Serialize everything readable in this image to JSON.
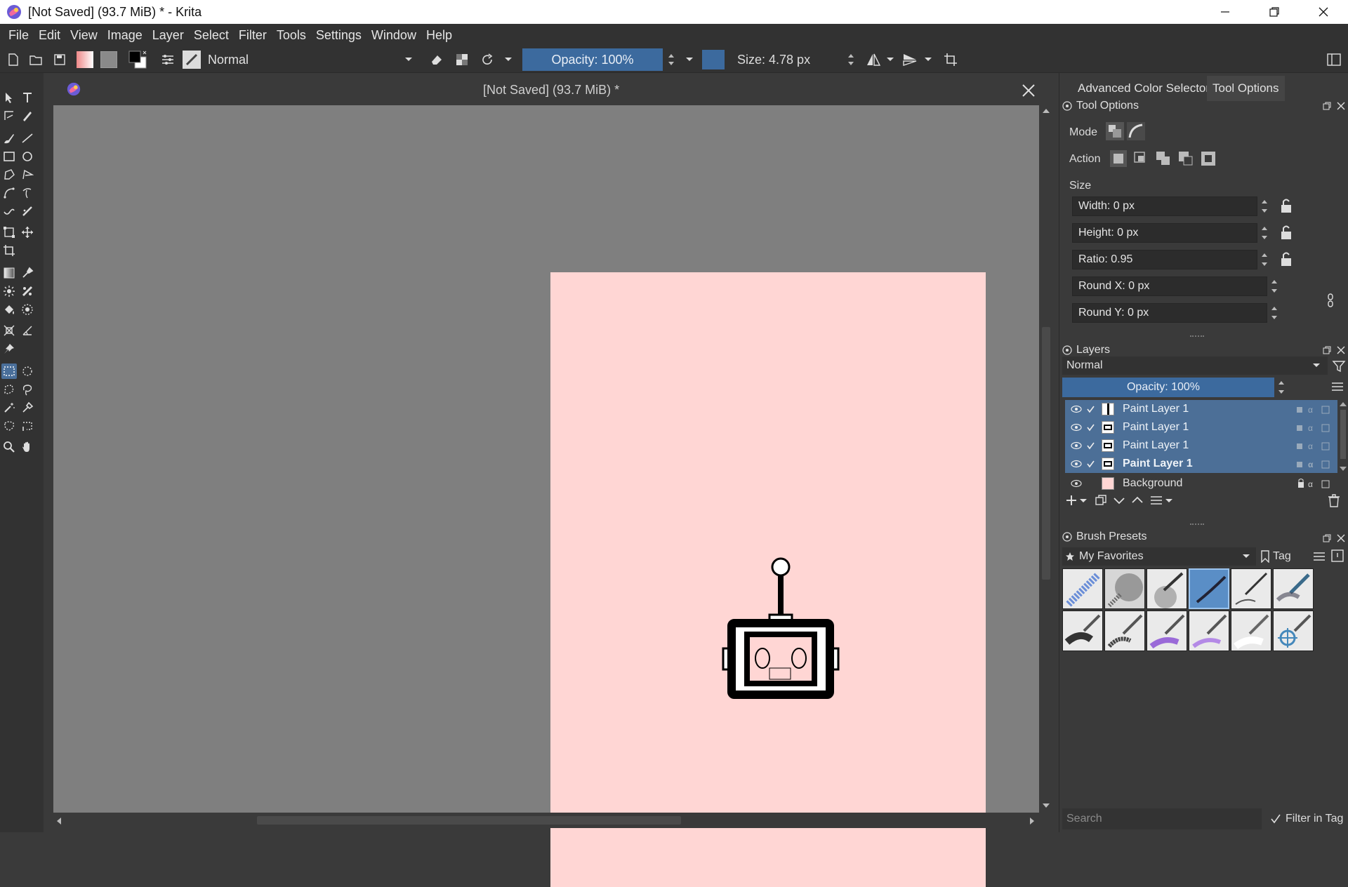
{
  "window": {
    "title": "[Not Saved]  (93.7 MiB) * - Krita"
  },
  "menubar": [
    "File",
    "Edit",
    "View",
    "Image",
    "Layer",
    "Select",
    "Filter",
    "Tools",
    "Settings",
    "Window",
    "Help"
  ],
  "toolbar": {
    "blend_mode": "Normal",
    "opacity": "Opacity: 100%",
    "opacity_value": 1.0,
    "size": "Size: 4.78 px"
  },
  "document": {
    "tab_title": "[Not Saved]  (93.7 MiB) *",
    "canvas_color": "#ffd6d4"
  },
  "dock": {
    "tabs": [
      "Advanced Color Selector",
      "Tool Options"
    ],
    "active_tab": "Tool Options",
    "tool_options": {
      "title": "Tool Options",
      "mode_label": "Mode",
      "action_label": "Action",
      "size_label": "Size",
      "width": "Width: 0 px",
      "height": "Height: 0 px",
      "ratio": "Ratio: 0.95",
      "round_x": "Round X: 0 px",
      "round_y": "Round Y: 0 px"
    },
    "layers": {
      "title": "Layers",
      "blend_mode": "Normal",
      "opacity": "Opacity: 100%",
      "items": [
        {
          "name": "Paint Layer 1",
          "selected": true,
          "bold": false
        },
        {
          "name": "Paint Layer 1",
          "selected": true,
          "bold": false
        },
        {
          "name": "Paint Layer 1",
          "selected": true,
          "bold": false
        },
        {
          "name": "Paint Layer 1",
          "selected": true,
          "bold": true
        },
        {
          "name": "Background",
          "selected": false,
          "bold": false
        }
      ]
    },
    "brush_presets": {
      "title": "Brush Presets",
      "tag": "My Favorites",
      "tag_button": "Tag",
      "search_placeholder": "Search",
      "filter_in_tag": "Filter in Tag"
    }
  },
  "colors": {
    "accent": "#4c6f97",
    "slider": "#3c6a9e",
    "panel": "#3a3a3a"
  }
}
